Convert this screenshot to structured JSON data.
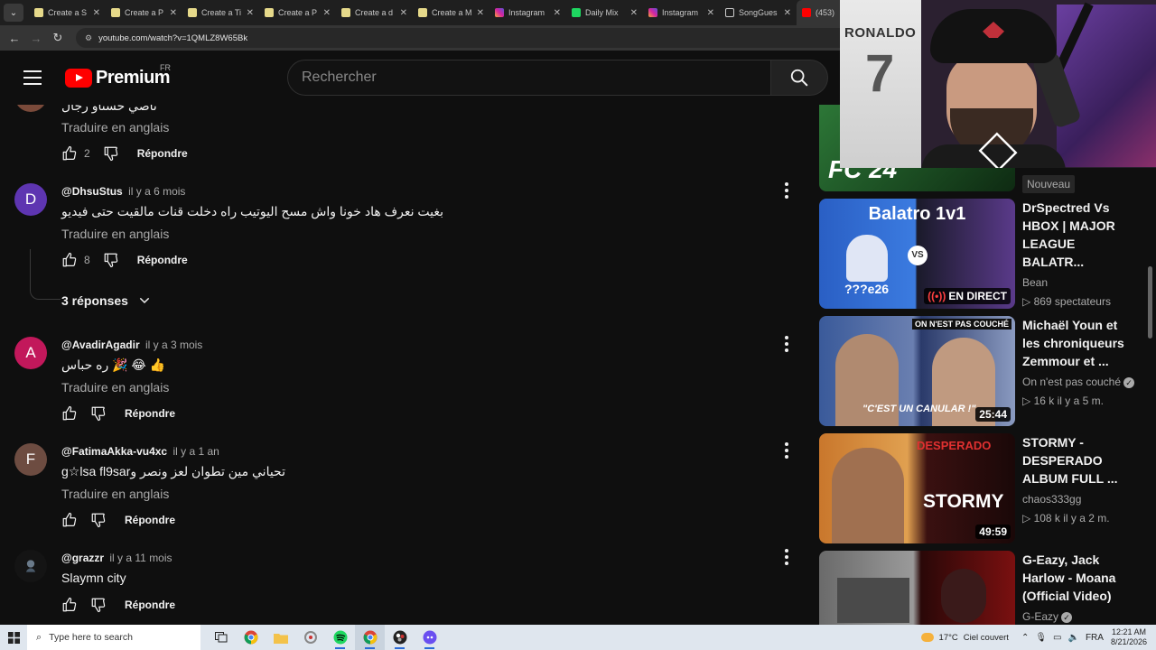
{
  "browser": {
    "tabs": [
      {
        "label": "Create a S",
        "icon": "doc"
      },
      {
        "label": "Create a P",
        "icon": "doc"
      },
      {
        "label": "Create a Ti",
        "icon": "doc"
      },
      {
        "label": "Create a P",
        "icon": "doc"
      },
      {
        "label": "Create a d",
        "icon": "doc"
      },
      {
        "label": "Create a M",
        "icon": "doc"
      },
      {
        "label": "Instagram",
        "icon": "instagram"
      },
      {
        "label": "Daily Mix",
        "icon": "spotify"
      },
      {
        "label": "Instagram",
        "icon": "instagram"
      },
      {
        "label": "SongGues",
        "icon": "headphones"
      },
      {
        "label": "(453)",
        "icon": "youtube"
      }
    ],
    "url": "youtube.com/watch?v=1QMLZ8W65Bk"
  },
  "youtube": {
    "logo_text": "Premium",
    "country_code": "FR",
    "search_placeholder": "Rechercher"
  },
  "comments": {
    "partial_text": "ناصي حسناو رجال",
    "partial_translate": "Traduire en anglais",
    "partial_likes": "2",
    "reply_label": "Répondre",
    "replies_toggle": "3 réponses",
    "items": [
      {
        "avatar_letter": "D",
        "avatar_color": "#5e35b1",
        "handle": "@DhsuStus",
        "time": "il y a 6 mois",
        "text": "بغيت نعرف هاد خونا واش مسح اليوتيب راه دخلت قنات مالقيت حتى فيديو",
        "translate": "Traduire en anglais",
        "likes": "8"
      },
      {
        "avatar_letter": "A",
        "avatar_color": "#c2185b",
        "handle": "@AvadirAgadir",
        "time": "il y a 3 mois",
        "text": "👍 😂 🎉 ره حباس",
        "translate": "Traduire en anglais",
        "likes": ""
      },
      {
        "avatar_letter": "F",
        "avatar_color": "#6d4c41",
        "handle": "@FatimaAkka-vu4xc",
        "time": "il y a 1 an",
        "text": "تحياني مين تطوان لعز ونصر وg☆lsa fl9sar",
        "translate": "Traduire en anglais",
        "likes": ""
      },
      {
        "avatar_letter": "",
        "avatar_color": "#1a1a1a",
        "handle": "@grazzr",
        "time": "il y a 11 mois",
        "text": "Slaymn city",
        "translate": "",
        "likes": ""
      }
    ]
  },
  "related": {
    "top_badge": "Nouveau",
    "videos": [
      {
        "title": "DrSpectred Vs HBOX | MAJOR LEAGUE BALATR...",
        "channel": "Bean",
        "meta": "▷ 869 spectateurs",
        "badge": "EN DIRECT",
        "thumb_text": "Balatro 1v1",
        "thumb_sub": "???e26"
      },
      {
        "title": "Michaël Youn et les chroniqueurs Zemmour et ...",
        "channel": "On n'est pas couché",
        "meta": "▷ 16 k   il y a 5 m.",
        "duration": "25:44",
        "thumb_text": "\"C'EST UN CANULAR !\"",
        "thumb_sub": "ON N'EST PAS COUCHÉ"
      },
      {
        "title": "STORMY - DESPERADO ALBUM FULL ...",
        "channel": "chaos333gg",
        "meta": "▷ 108 k   il y a 2 m.",
        "duration": "49:59",
        "thumb_text": "STORMY",
        "thumb_sub": "DESPERADO"
      },
      {
        "title": "G-Eazy, Jack Harlow - Moana (Official Video)",
        "channel": "G-Eazy",
        "meta": "",
        "duration": ""
      }
    ]
  },
  "webcam": {
    "jersey_name": "RONALDO",
    "jersey_number": "7",
    "game_logo": "FC 24"
  },
  "taskbar": {
    "search_placeholder": "Type here to search",
    "weather_temp": "17°C",
    "weather_text": "Ciel couvert",
    "language": "FRA",
    "time": "12:21 AM",
    "date": "8/21/2026"
  }
}
